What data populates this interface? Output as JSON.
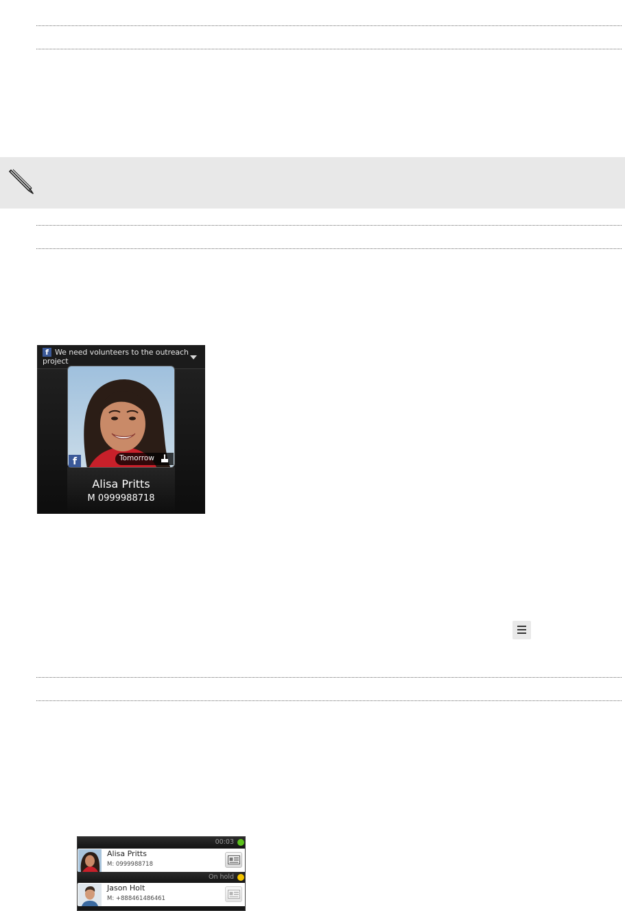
{
  "incoming_call": {
    "facebook_status": "We need volunteers to the outreach project",
    "event_label": "Tomorrow",
    "caller_name": "Alisa Pritts",
    "caller_number": "M 0999988718"
  },
  "calls_list": {
    "active_timer": "00:03",
    "hold_label": "On hold",
    "calls": [
      {
        "name": "Alisa Pritts",
        "number": "M: 0999988718"
      },
      {
        "name": "Jason Holt",
        "number": "M: +888461486461"
      }
    ]
  },
  "colors": {
    "active_dot": "#5cc21c",
    "hold_dot": "#f4c400",
    "facebook": "#3b5998"
  }
}
